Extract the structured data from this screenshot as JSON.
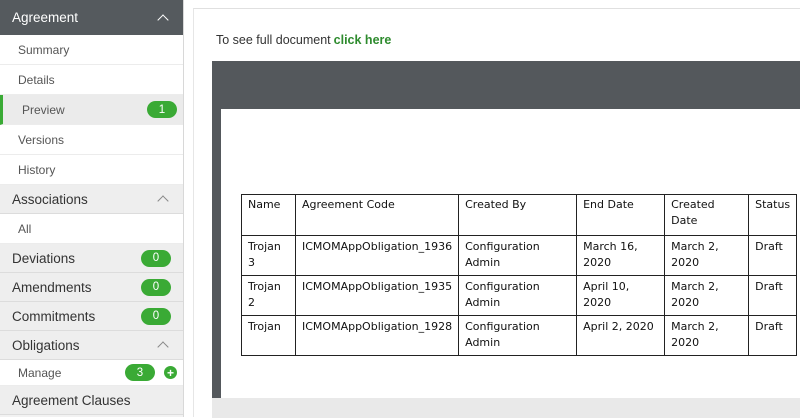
{
  "sidebar": {
    "agreement": {
      "label": "Agreement",
      "items": [
        {
          "label": "Summary"
        },
        {
          "label": "Details"
        },
        {
          "label": "Preview",
          "badge": "1"
        },
        {
          "label": "Versions"
        },
        {
          "label": "History"
        }
      ]
    },
    "associations": {
      "label": "Associations",
      "items": [
        {
          "label": "All"
        }
      ]
    },
    "deviations": {
      "label": "Deviations",
      "badge": "0"
    },
    "amendments": {
      "label": "Amendments",
      "badge": "0"
    },
    "commitments": {
      "label": "Commitments",
      "badge": "0"
    },
    "obligations": {
      "label": "Obligations",
      "items": [
        {
          "label": "Manage",
          "badge": "3"
        }
      ]
    },
    "agreement_clauses": {
      "label": "Agreement Clauses"
    }
  },
  "main": {
    "see_full_text": "To see full document",
    "click_here": "click here",
    "table": {
      "headers": [
        "Name",
        "Agreement Code",
        "Created By",
        "End Date",
        "Created Date",
        "Status"
      ],
      "rows": [
        {
          "name": [
            "Trojan",
            "3"
          ],
          "code": "ICMOMAppObligation_1936",
          "created_by": [
            "Configuration",
            "Admin"
          ],
          "end_date": [
            "March 16,",
            "2020"
          ],
          "created_date": [
            "March 2,",
            "2020"
          ],
          "status": "Draft"
        },
        {
          "name": [
            "Trojan",
            "2"
          ],
          "code": "ICMOMAppObligation_1935",
          "created_by": [
            "Configuration",
            "Admin"
          ],
          "end_date": [
            "April 10, 2020",
            ""
          ],
          "created_date": [
            "March 2,",
            "2020"
          ],
          "status": "Draft"
        },
        {
          "name": [
            "Trojan",
            ""
          ],
          "code": "ICMOMAppObligation_1928",
          "created_by": [
            "Configuration",
            "Admin"
          ],
          "end_date": [
            "April 2, 2020",
            ""
          ],
          "created_date": [
            "March 2,",
            "2020"
          ],
          "status": "Draft"
        }
      ]
    }
  },
  "colors": {
    "accent": "#3aaa35",
    "header_dark": "#555a5e",
    "viewer_dark": "#54585c"
  }
}
